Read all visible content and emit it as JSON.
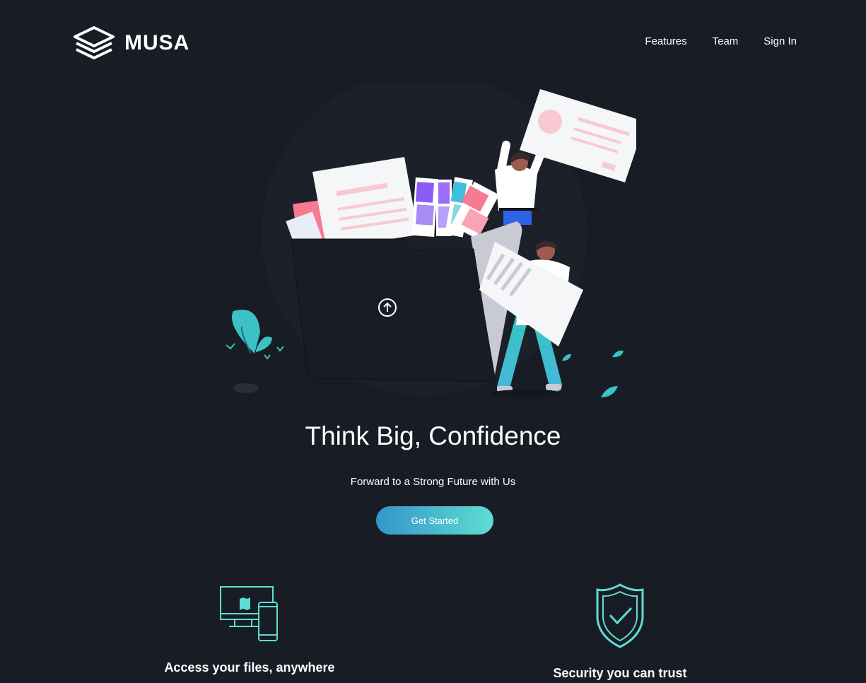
{
  "brand": {
    "name": "MUSA",
    "logo_icon": "stacked-layers-icon"
  },
  "nav": {
    "items": [
      "Features",
      "Team",
      "Sign In"
    ]
  },
  "hero": {
    "title": "Think Big, Confidence",
    "subtitle": "Forward to a Strong Future with Us",
    "cta_label": "Get Started",
    "illustration": "people-with-folder-illustration",
    "upload_icon": "arrow-up-circle-icon"
  },
  "features": [
    {
      "icon": "devices-icon",
      "title": "Access your files, anywhere"
    },
    {
      "icon": "shield-check-icon",
      "title": "Security you can trust"
    }
  ],
  "colors": {
    "background": "#181c24",
    "accent_start": "#3496c9",
    "accent_end": "#5fdcd2",
    "teal": "#5fdcd2",
    "pink": "#f67b92"
  }
}
